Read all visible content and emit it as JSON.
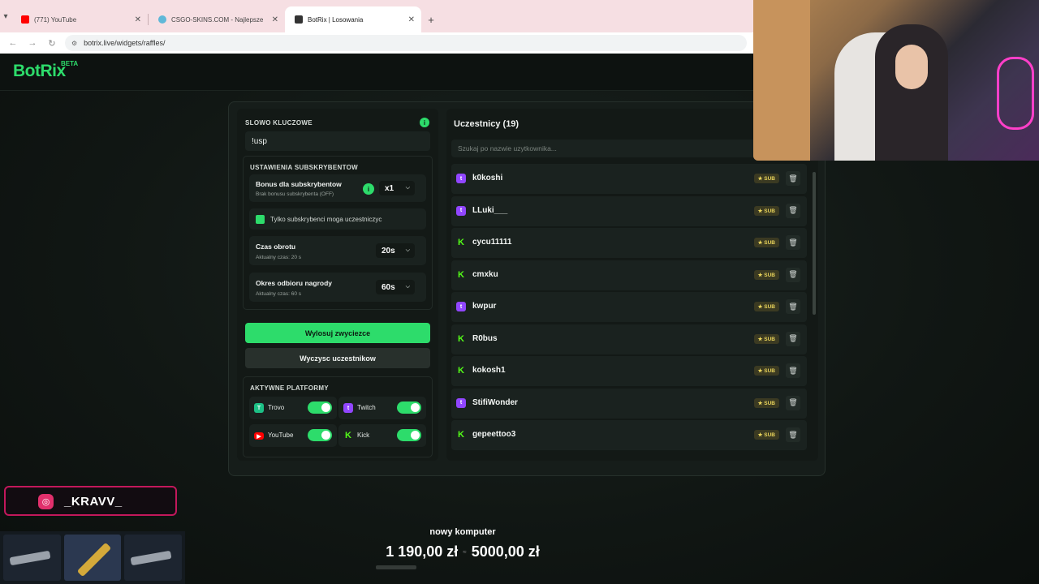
{
  "browser": {
    "tabs": [
      {
        "title": "(771) YouTube",
        "favicon_color": "#ff0000",
        "active": false
      },
      {
        "title": "CSGO-SKINS.COM - Najlepsze",
        "favicon_color": "#5fb8d8",
        "active": false
      },
      {
        "title": "BotRix | Losowania",
        "favicon_color": "#333333",
        "active": true
      }
    ],
    "url": "botrix.live/widgets/raffles/"
  },
  "site": {
    "logo": "BotRix",
    "logo_badge": "BETA",
    "accent": "#2ddc6b"
  },
  "settings": {
    "keyword_label": "SLOWO KLUCZOWE",
    "keyword_value": "!usp",
    "subs_section_title": "USTAWIENIA SUBSKRYBENTOW",
    "bonus": {
      "title": "Bonus dla subskrybentow",
      "subtitle": "Brak bonusu subskrybenta (OFF)",
      "value": "x1"
    },
    "subs_only": {
      "label": "Tylko subskrybenci moga uczestniczyc",
      "checked": true
    },
    "spin_time": {
      "title": "Czas obrotu",
      "subtitle": "Aktualny czas: 20 s",
      "value": "20s"
    },
    "claim_time": {
      "title": "Okres odbioru nagrody",
      "subtitle": "Aktualny czas: 60 s",
      "value": "60s"
    },
    "draw_button": "Wylosuj zwyciezce",
    "clear_button": "Wyczysc uczestnikow",
    "platforms_title": "AKTYWNE PLATFORMY",
    "platforms": [
      {
        "name": "Trovo",
        "icon": "trovo-icon",
        "color": "#1dc186",
        "enabled": true
      },
      {
        "name": "Twitch",
        "icon": "twitch-icon",
        "color": "#9146ff",
        "enabled": true
      },
      {
        "name": "YouTube",
        "icon": "youtube-icon",
        "color": "#ff0000",
        "enabled": true
      },
      {
        "name": "Kick",
        "icon": "kick-icon",
        "color": "#53fc18",
        "enabled": true
      }
    ]
  },
  "participants": {
    "title": "Uczestnicy (19)",
    "search_placeholder": "Szukaj po nazwie uzytkownika...",
    "badge_label": "★ SUB",
    "items": [
      {
        "name": "k0koshi",
        "platform": "twitch"
      },
      {
        "name": "LLuki___",
        "platform": "twitch"
      },
      {
        "name": "cycu11111",
        "platform": "kick"
      },
      {
        "name": "cmxku",
        "platform": "kick"
      },
      {
        "name": "kwpur",
        "platform": "twitch"
      },
      {
        "name": "R0bus",
        "platform": "kick"
      },
      {
        "name": "kokosh1",
        "platform": "kick"
      },
      {
        "name": "StifiWonder",
        "platform": "twitch"
      },
      {
        "name": "gepeettoo3",
        "platform": "kick"
      }
    ]
  },
  "overlay": {
    "instagram_handle": "_KRAVV_",
    "goal_title": "nowy komputer",
    "goal_current": "1 190,00 zł",
    "goal_target": "5000,00 zł",
    "goal_progress": 0.238
  }
}
